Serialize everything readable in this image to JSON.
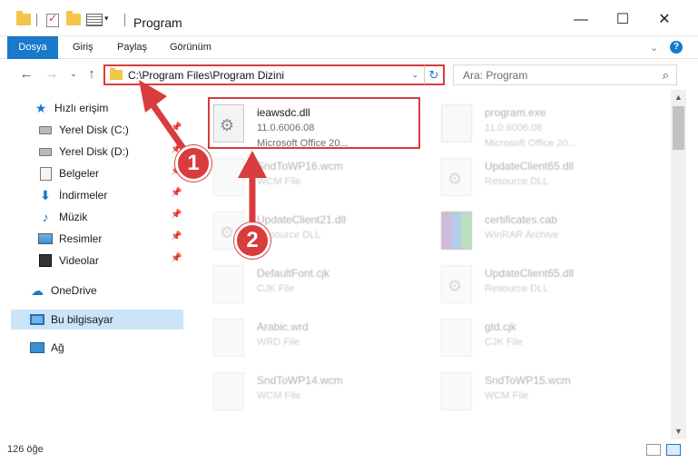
{
  "window": {
    "title": "Program",
    "qa_caret": "▾",
    "minimize_glyph": "—",
    "maximize_glyph": "☐",
    "close_glyph": "✕"
  },
  "ribbon": {
    "tabs": [
      "Dosya",
      "Giriş",
      "Paylaş",
      "Görünüm"
    ],
    "expand_glyph": "⌄",
    "help_glyph": "?"
  },
  "nav": {
    "back_glyph": "←",
    "forward_glyph": "→",
    "recent_glyph": "⌄",
    "up_glyph": "↑",
    "address": "C:\\Program Files\\Program Dizini",
    "address_caret": "⌄",
    "refresh_glyph": "↻",
    "search_placeholder": "Ara: Program",
    "search_glyph": "⌕"
  },
  "sidebar": {
    "items": [
      {
        "label": "Hızlı erişim",
        "icon": "star-icon"
      },
      {
        "label": "Yerel Disk (C:)",
        "icon": "drive-icon"
      },
      {
        "label": "Yerel Disk (D:)",
        "icon": "drive-icon"
      },
      {
        "label": "Belgeler",
        "icon": "documents-icon"
      },
      {
        "label": "İndirmeler",
        "icon": "download-icon"
      },
      {
        "label": "Müzik",
        "icon": "music-icon"
      },
      {
        "label": "Resimler",
        "icon": "pictures-icon"
      },
      {
        "label": "Videolar",
        "icon": "video-icon"
      },
      {
        "label": "OneDrive",
        "icon": "cloud-icon"
      },
      {
        "label": "Bu bilgisayar",
        "icon": "computer-icon"
      },
      {
        "label": "Ağ",
        "icon": "network-icon"
      }
    ],
    "pin_glyph": "📌"
  },
  "files": [
    {
      "name": "ieawsdc.dll",
      "line1": "11.0.6006.08",
      "line2": "Microsoft Office 20...",
      "icon": "gear-file-icon"
    },
    {
      "name": "program.exe",
      "line1": "11.0.6006.08",
      "line2": "Microsoft Office 20...",
      "icon": "exe-file-icon"
    },
    {
      "name": "SndToWP16.wcm",
      "line1": "WCM File",
      "icon": "blank-file-icon"
    },
    {
      "name": "UpdateClient65.dll",
      "line1": "Resource DLL",
      "icon": "gear-file-icon"
    },
    {
      "name": "UpdateClient21.dll",
      "line1": "Resource DLL",
      "icon": "gear-file-icon"
    },
    {
      "name": "certificates.cab",
      "line1": "WinRAR Archive",
      "icon": "winrar-icon"
    },
    {
      "name": "DefaultFont.cjk",
      "line1": "CJK File",
      "icon": "blank-file-icon"
    },
    {
      "name": "UpdateClient65.dll",
      "line1": "Resource DLL",
      "icon": "gear-file-icon"
    },
    {
      "name": "Arabic.wrd",
      "line1": "WRD File",
      "icon": "blank-file-icon"
    },
    {
      "name": "gtd.cjk",
      "line1": "CJK File",
      "icon": "blank-file-icon"
    },
    {
      "name": "SndToWP14.wcm",
      "line1": "WCM File",
      "icon": "blank-file-icon"
    },
    {
      "name": "SndToWP15.wcm",
      "line1": "WCM File",
      "icon": "blank-file-icon"
    }
  ],
  "scroll": {
    "up_glyph": "▲",
    "down_glyph": "▼"
  },
  "status": {
    "count": "126 öğe"
  },
  "annotations": {
    "badge1": "1",
    "badge2": "2"
  },
  "colors": {
    "accent": "#1979ca",
    "highlight": "#d83c3c",
    "selected": "#cce4f7"
  }
}
